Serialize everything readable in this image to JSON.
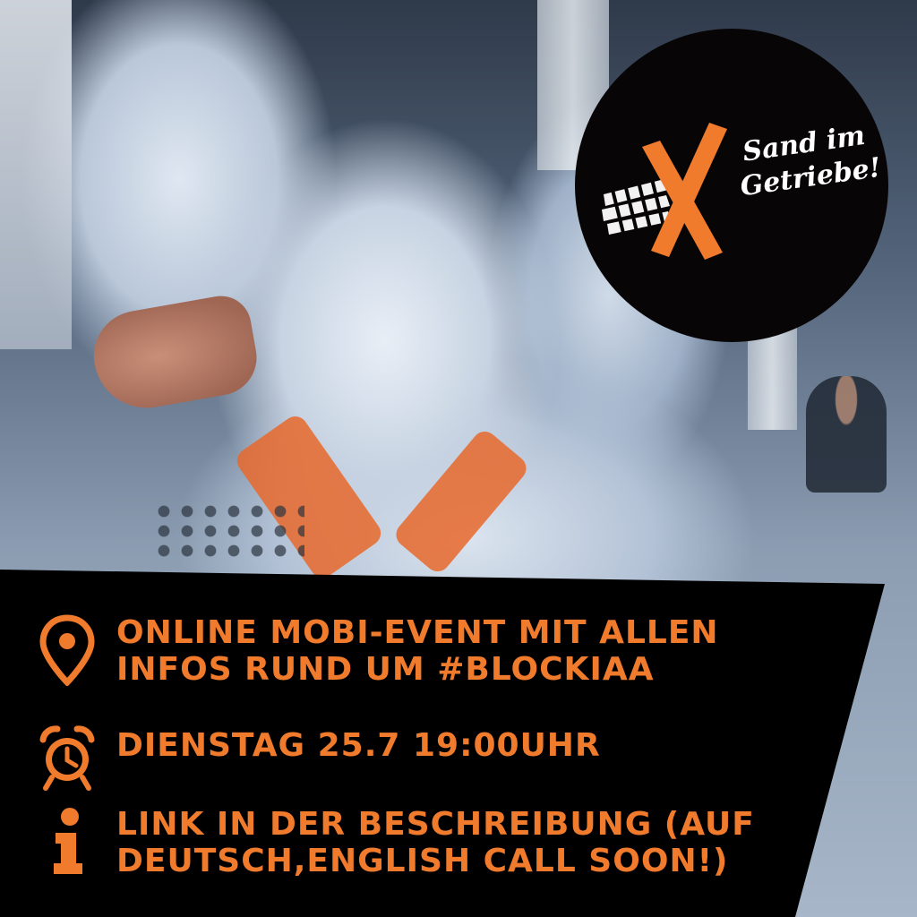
{
  "logo": {
    "line1": "Sand im",
    "line2": "Getriebe!",
    "icon": "orange-x-with-tire-track-icon"
  },
  "info": {
    "event": {
      "icon": "location-pin-icon",
      "line1": "ONLINE MOBI-EVENT MIT ALLEN",
      "line2": "INFOS RUND UM #BLOCKIAA"
    },
    "time": {
      "icon": "alarm-clock-icon",
      "line1": "DIENSTAG 25.7 19:00UHR"
    },
    "link": {
      "icon": "info-i-icon",
      "line1": "LINK IN DER BESCHREIBUNG (AUF",
      "line2": "DEUTSCH,ENGLISH CALL SOON!)"
    }
  },
  "colors": {
    "accent": "#f07b2c",
    "panel": "#000000",
    "logo_bg": "#080506"
  }
}
